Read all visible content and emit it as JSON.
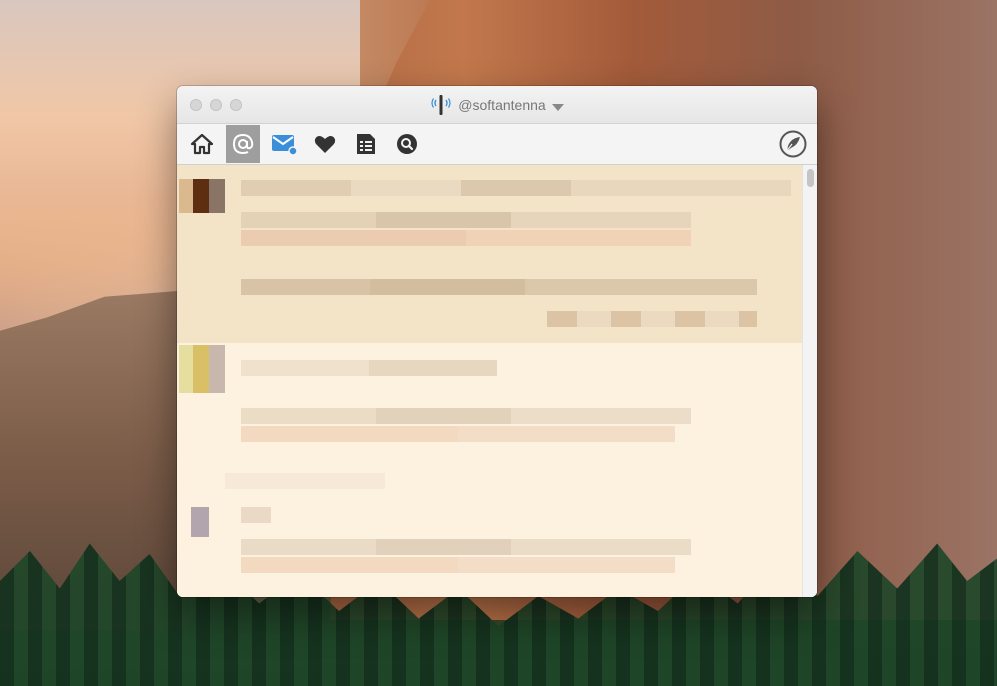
{
  "window": {
    "account_handle": "@softantenna"
  },
  "toolbar": {
    "tabs": [
      {
        "name": "home-icon",
        "active": false
      },
      {
        "name": "mentions-icon",
        "active": true
      },
      {
        "name": "messages-icon",
        "active": false,
        "badge": true
      },
      {
        "name": "favorites-icon",
        "active": false
      },
      {
        "name": "lists-icon",
        "active": false
      },
      {
        "name": "search-icon",
        "active": false
      }
    ],
    "compose_icon": "quill-icon"
  },
  "colors": {
    "accent": "#3b8fd8",
    "tweet_highlight_bg": "#f3e4c7",
    "tweet_bg": "#fdf2df"
  },
  "timeline": {
    "tweets": [
      {
        "state": "highlighted",
        "content": "pixelated"
      },
      {
        "state": "normal",
        "content": "pixelated"
      },
      {
        "state": "normal",
        "content": "pixelated"
      }
    ]
  }
}
